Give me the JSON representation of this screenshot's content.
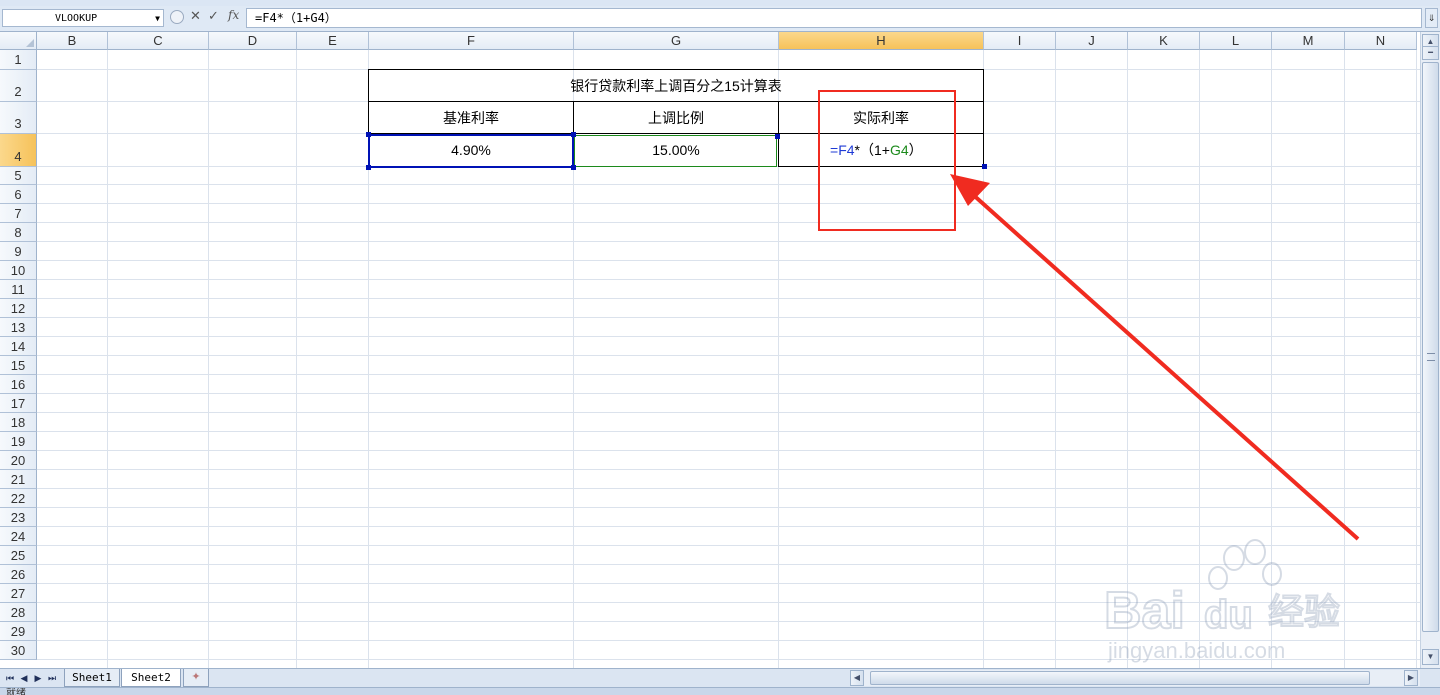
{
  "formula_bar": {
    "name_box": "VLOOKUP",
    "cancel_icon": "✕",
    "enter_icon": "✓",
    "fx_icon": "fx",
    "formula": "=F4*（1+G4）"
  },
  "columns": [
    "B",
    "C",
    "D",
    "E",
    "F",
    "G",
    "H",
    "I",
    "J",
    "K",
    "L",
    "M",
    "N"
  ],
  "selected_column": "H",
  "rows": [
    "1",
    "2",
    "3",
    "4",
    "5",
    "6",
    "7",
    "8",
    "9",
    "10",
    "11",
    "12",
    "13",
    "14",
    "15",
    "16",
    "17",
    "18",
    "19",
    "20",
    "21",
    "22",
    "23",
    "24",
    "25",
    "26",
    "27",
    "28",
    "29",
    "30"
  ],
  "selected_row": "4",
  "table": {
    "title": "银行贷款利率上调百分之15计算表",
    "headers": [
      "基准利率",
      "上调比例",
      "实际利率"
    ],
    "base_rate": "4.90%",
    "increase_ratio": "15.00%",
    "formula_parts": {
      "eq": "=",
      "ref1": "F4",
      "op": "*（1+",
      "ref2": "G4",
      "close": "）"
    }
  },
  "colors": {
    "ref1": "#1f3bd6",
    "ref2": "#1c8a1c",
    "annotation": "#f02b20",
    "selection": "#0012b5"
  },
  "sheet_tabs": [
    "Sheet1",
    "Sheet2"
  ],
  "active_sheet": "Sheet2",
  "status": "就绪",
  "watermark": {
    "brand": "Bai",
    "brand2": "du",
    "cn": "经验",
    "url": "jingyan.baidu.com"
  }
}
